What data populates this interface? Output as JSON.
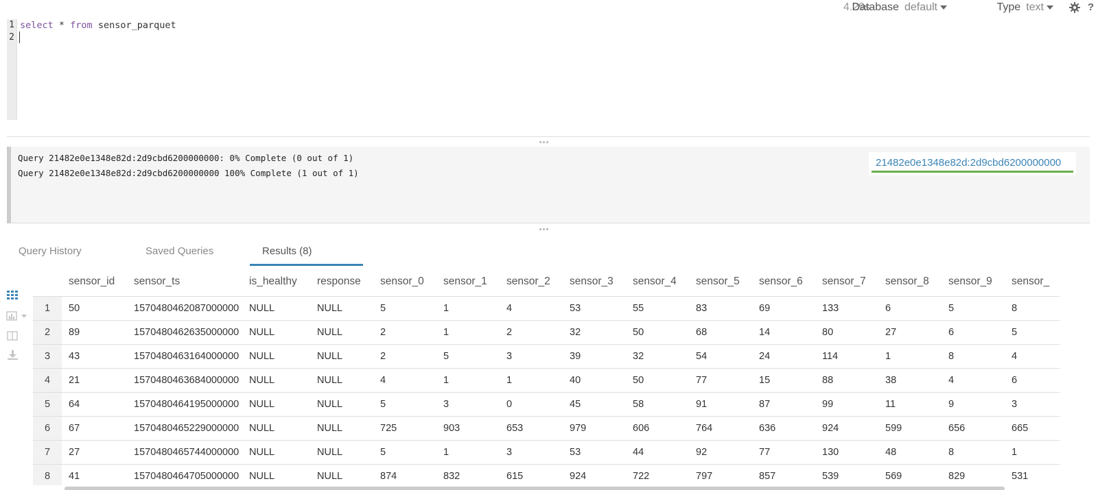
{
  "toolbar": {
    "elapsed": "4.29s",
    "database_label": "Database",
    "database_value": "default",
    "type_label": "Type",
    "type_value": "text",
    "help": "?"
  },
  "editor": {
    "line_numbers": [
      "1",
      "2"
    ],
    "code": {
      "kw1": "select",
      "star": " * ",
      "kw2": "from",
      "table": " sensor_parquet"
    }
  },
  "log": {
    "lines": [
      "Query 21482e0e1348e82d:2d9cbd6200000000: 0% Complete (0 out of 1)",
      "Query 21482e0e1348e82d:2d9cbd6200000000 100% Complete (1 out of 1)"
    ],
    "job_link": "21482e0e1348e82d:2d9cbd6200000000"
  },
  "tabs": {
    "history": "Query History",
    "saved": "Saved Queries",
    "results": "Results (8)"
  },
  "sidebar_icons": [
    "grid-view-icon",
    "chart-view-icon",
    "columns-icon",
    "download-icon"
  ],
  "results": {
    "columns": [
      "",
      "sensor_id",
      "sensor_ts",
      "is_healthy",
      "response",
      "sensor_0",
      "sensor_1",
      "sensor_2",
      "sensor_3",
      "sensor_4",
      "sensor_5",
      "sensor_6",
      "sensor_7",
      "sensor_8",
      "sensor_9",
      "sensor_"
    ],
    "rows": [
      [
        "1",
        "50",
        "1570480462087000000",
        "NULL",
        "NULL",
        "5",
        "1",
        "4",
        "53",
        "55",
        "83",
        "69",
        "133",
        "6",
        "5",
        "8"
      ],
      [
        "2",
        "89",
        "1570480462635000000",
        "NULL",
        "NULL",
        "2",
        "1",
        "2",
        "32",
        "50",
        "68",
        "14",
        "80",
        "27",
        "6",
        "5"
      ],
      [
        "3",
        "43",
        "1570480463164000000",
        "NULL",
        "NULL",
        "2",
        "5",
        "3",
        "39",
        "32",
        "54",
        "24",
        "114",
        "1",
        "8",
        "4"
      ],
      [
        "4",
        "21",
        "1570480463684000000",
        "NULL",
        "NULL",
        "4",
        "1",
        "1",
        "40",
        "50",
        "77",
        "15",
        "88",
        "38",
        "4",
        "6"
      ],
      [
        "5",
        "64",
        "1570480464195000000",
        "NULL",
        "NULL",
        "5",
        "3",
        "0",
        "45",
        "58",
        "91",
        "87",
        "99",
        "11",
        "9",
        "3"
      ],
      [
        "6",
        "67",
        "1570480465229000000",
        "NULL",
        "NULL",
        "725",
        "903",
        "653",
        "979",
        "606",
        "764",
        "636",
        "924",
        "599",
        "656",
        "665"
      ],
      [
        "7",
        "27",
        "1570480465744000000",
        "NULL",
        "NULL",
        "5",
        "1",
        "3",
        "53",
        "44",
        "92",
        "77",
        "130",
        "48",
        "8",
        "1"
      ],
      [
        "8",
        "41",
        "1570480464705000000",
        "NULL",
        "NULL",
        "874",
        "832",
        "615",
        "924",
        "722",
        "797",
        "857",
        "539",
        "569",
        "829",
        "531"
      ]
    ]
  }
}
